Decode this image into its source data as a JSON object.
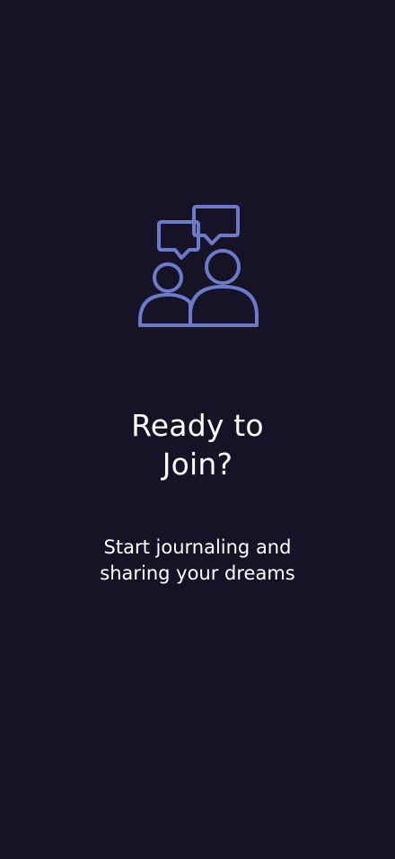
{
  "onboarding": {
    "icon": "people-chat-icon",
    "title_line_1": "Ready to",
    "title_line_2": "Join?",
    "subtitle_line_1": "Start journaling and",
    "subtitle_line_2": "sharing your dreams"
  },
  "colors": {
    "background": "#161326",
    "icon_stroke": "#6b7bc9",
    "text": "#ffffff"
  }
}
